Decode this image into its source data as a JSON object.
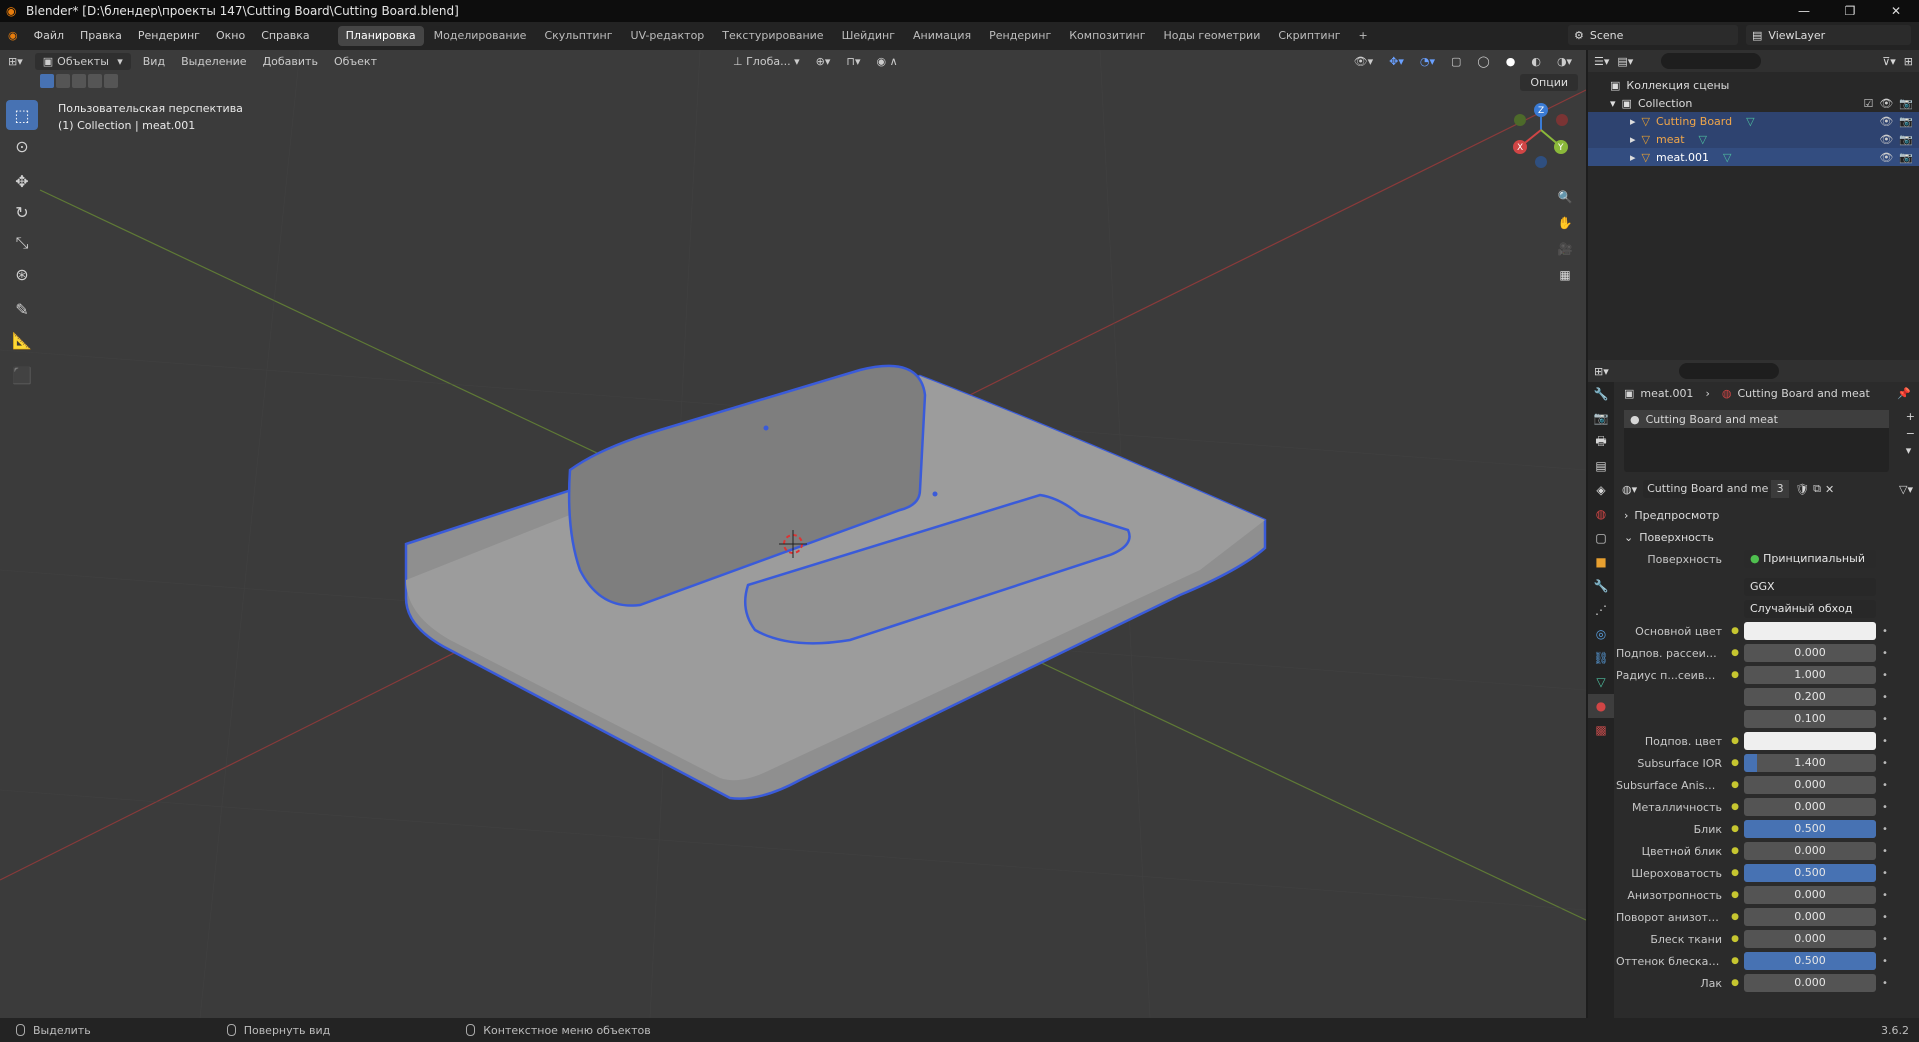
{
  "window": {
    "title": "Blender* [D:\\блендер\\проекты 147\\Cutting Board\\Cutting Board.blend]",
    "controls": [
      "—",
      "❐",
      "✕"
    ]
  },
  "menubar": {
    "menus": [
      "Файл",
      "Правка",
      "Рендеринг",
      "Окно",
      "Справка"
    ],
    "workspaces": [
      "Планировка",
      "Моделирование",
      "Скульптинг",
      "UV-редактор",
      "Текстурирование",
      "Шейдинг",
      "Анимация",
      "Рендеринг",
      "Композитинг",
      "Ноды геометрии",
      "Скриптинг"
    ],
    "active_workspace_index": 0,
    "add_tab": "+",
    "scene": "Scene",
    "view_layer": "ViewLayer"
  },
  "viewport": {
    "mode": "Объекты",
    "menus": [
      "Вид",
      "Выделение",
      "Добавить",
      "Объект"
    ],
    "transform_orientation": "Глоба...",
    "options": "Опции",
    "info_line1": "Пользовательская перспектива",
    "info_line2": "(1) Collection | meat.001",
    "gizmo_axes": [
      "X",
      "Y",
      "Z"
    ]
  },
  "outliner": {
    "root": "Коллекция сцены",
    "collection": "Collection",
    "items": [
      {
        "name": "Cutting Board",
        "selected": "partial"
      },
      {
        "name": "meat",
        "selected": "partial"
      },
      {
        "name": "meat.001",
        "selected": "active"
      }
    ]
  },
  "properties": {
    "breadcrumb_object": "meat.001",
    "breadcrumb_material": "Cutting Board and meat",
    "material_slot": "Cutting Board and meat",
    "material_name": "Cutting Board and meat",
    "user_count": "3",
    "sections": {
      "preview": "Предпросмотр",
      "surface": "Поверхность"
    },
    "surface_label": "Поверхность",
    "surface_value": "Принципиальный BSDF",
    "distribution": "GGX",
    "subsurface_method": "Случайный обход",
    "rows": [
      {
        "label": "Основной цвет",
        "value": "",
        "type": "color"
      },
      {
        "label": "Подпов. рассеива...",
        "value": "0.000",
        "fill": 0
      },
      {
        "label": "Радиус п...сеивания",
        "value": "1.000",
        "fill": 0
      },
      {
        "label": "",
        "value": "0.200",
        "fill": 0
      },
      {
        "label": "",
        "value": "0.100",
        "fill": 0
      },
      {
        "label": "Подпов. цвет",
        "value": "",
        "type": "color"
      },
      {
        "label": "Subsurface IOR",
        "value": "1.400",
        "fill": 0.1
      },
      {
        "label": "Subsurface Anisotr...",
        "value": "0.000",
        "fill": 0
      },
      {
        "label": "Металличность",
        "value": "0.000",
        "fill": 0
      },
      {
        "label": "Блик",
        "value": "0.500",
        "fill": 1
      },
      {
        "label": "Цветной блик",
        "value": "0.000",
        "fill": 0
      },
      {
        "label": "Шероховатость",
        "value": "0.500",
        "fill": 1
      },
      {
        "label": "Анизотропность",
        "value": "0.000",
        "fill": 0
      },
      {
        "label": "Поворот анизотро...",
        "value": "0.000",
        "fill": 0
      },
      {
        "label": "Блеск ткани",
        "value": "0.000",
        "fill": 0
      },
      {
        "label": "Оттенок блеска тк...",
        "value": "0.500",
        "fill": 1
      },
      {
        "label": "Лак",
        "value": "0.000",
        "fill": 0
      }
    ]
  },
  "statusbar": {
    "select": "Выделить",
    "rotate": "Повернуть вид",
    "context": "Контекстное меню объектов",
    "version": "3.6.2"
  },
  "colors": {
    "accent": "#4772b3",
    "selection_outline": "#3a5bd9",
    "x_axis": "#c0392b",
    "y_axis": "#7aa33a"
  }
}
